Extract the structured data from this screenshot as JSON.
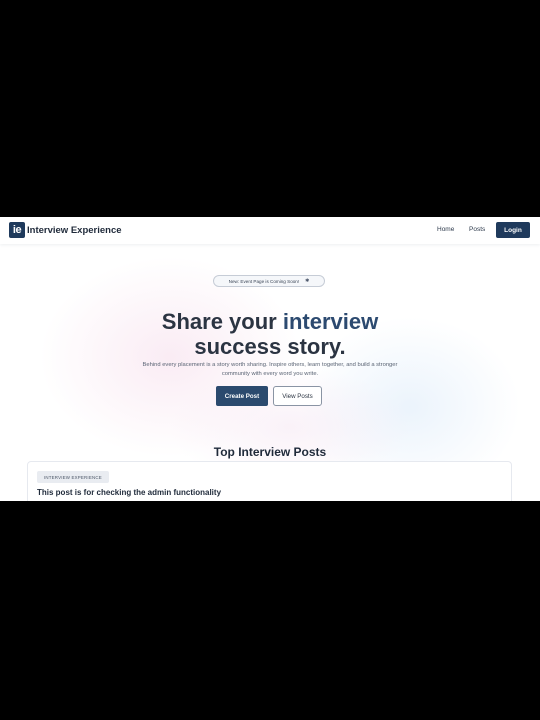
{
  "brand": {
    "logo_text": "ie",
    "name": "Interview Experience",
    "logo_color": "#1f3a5c"
  },
  "nav": {
    "home": "Home",
    "posts": "Posts",
    "login": "Login"
  },
  "announcement": {
    "text": "New: Event Page is Coming Soon!",
    "icon": "sparkle-icon",
    "glyph": "✱"
  },
  "hero": {
    "headline_part1": "Share your ",
    "headline_accent": "interview",
    "headline_part2": "success story.",
    "subtext": "Behind every placement is a story worth sharing. Inspire others, learn together, and build a stronger community with every word you write.",
    "primary_button": "Create Post",
    "secondary_button": "View Posts"
  },
  "top_posts": {
    "title": "Top Interview Posts",
    "items": [
      {
        "tag": "INTERVIEW EXPERIENCE",
        "title": "This post is for checking the admin functionality"
      }
    ]
  },
  "colors": {
    "primary": "#2b4a6e",
    "heading": "#2b3442",
    "accent_text": "#2c4a70",
    "letterbox": "#000000"
  }
}
